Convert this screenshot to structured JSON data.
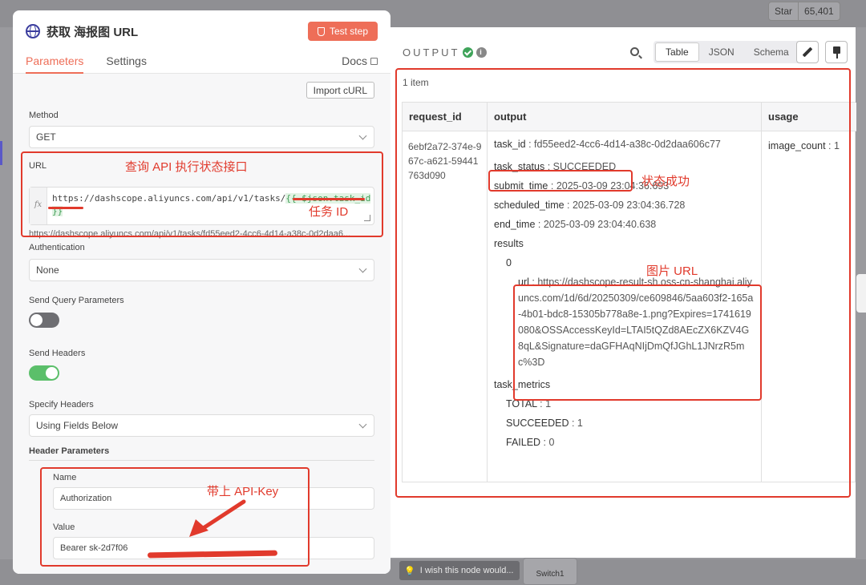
{
  "github": {
    "star_label": "Star",
    "star_count": "65,401"
  },
  "node": {
    "title": "获取 海报图 URL",
    "test_step_label": "Test step"
  },
  "tabs": {
    "parameters": "Parameters",
    "settings": "Settings",
    "docs": "Docs"
  },
  "params": {
    "import_curl_label": "Import cURL",
    "method_label": "Method",
    "method_value": "GET",
    "url_label": "URL",
    "url_prefix": "https://dashscope.aliyuncs.com/api/v1/tasks/",
    "url_expression": "{{ $json.task_id }}",
    "url_resolved": "https://dashscope.aliyuncs.com/api/v1/tasks/fd55eed2-4cc6-4d14-a38c-0d2daa6...",
    "authentication_label": "Authentication",
    "authentication_value": "None",
    "send_query_label": "Send Query Parameters",
    "send_query_enabled": false,
    "send_headers_label": "Send Headers",
    "send_headers_enabled": true,
    "specify_headers_label": "Specify Headers",
    "specify_headers_value": "Using Fields Below",
    "header_parameters_label": "Header Parameters",
    "header_name_label": "Name",
    "header_name_value": "Authorization",
    "header_value_label": "Value",
    "header_value_value": "Bearer  sk-2d7f06"
  },
  "output": {
    "title": "OUTPUT",
    "view_tabs": [
      "Table",
      "JSON",
      "Schema"
    ],
    "active_view": "Table",
    "item_count": "1 item",
    "columns": [
      "request_id",
      "output",
      "usage"
    ],
    "request_id": "6ebf2a72-374e-967c-a621-59441763d090",
    "task_id_key": "task_id",
    "task_id_value": "fd55eed2-4cc6-4d14-a38c-0d2daa606c77",
    "task_status_key": "task_status",
    "task_status_value": "SUCCEEDED",
    "submit_time_key": "submit_time",
    "submit_time_value": "2025-03-09 23:04:36.693",
    "scheduled_time_key": "scheduled_time",
    "scheduled_time_value": "2025-03-09 23:04:36.728",
    "end_time_key": "end_time",
    "end_time_value": "2025-03-09 23:04:40.638",
    "results_key": "results",
    "results_index": "0",
    "url_key": "url",
    "url_value": "https://dashscope-result-sh.oss-cn-shanghai.aliyuncs.com/1d/6d/20250309/ce609846/5aa603f2-165a-4b01-bdc8-15305b778a8e-1.png?Expires=1741619080&OSSAccessKeyId=LTAI5tQZd8AEcZX6KZV4G8qL&Signature=daGFHAqNIjDmQfJGhL1JNrzR5mc%3D",
    "task_metrics_key": "task_metrics",
    "total_key": "TOTAL",
    "total_value": "1",
    "succeeded_key": "SUCCEEDED",
    "succeeded_value": "1",
    "failed_key": "FAILED",
    "failed_value": "0",
    "usage_key": "image_count",
    "usage_value": "1"
  },
  "annotations": {
    "url_interface": "查询 API 执行状态接口",
    "task_id": "任务 ID",
    "status_success": "状态成功",
    "image_url": "图片 URL",
    "api_key": "带上 API-Key"
  },
  "canvas": {
    "hint": "I wish this node would...",
    "switch_node": "Switch1"
  },
  "colors": {
    "accent": "#ee6e58",
    "success": "#3fa45a",
    "annotation": "#e13a2c",
    "toggle_on": "#5bbf6a"
  }
}
